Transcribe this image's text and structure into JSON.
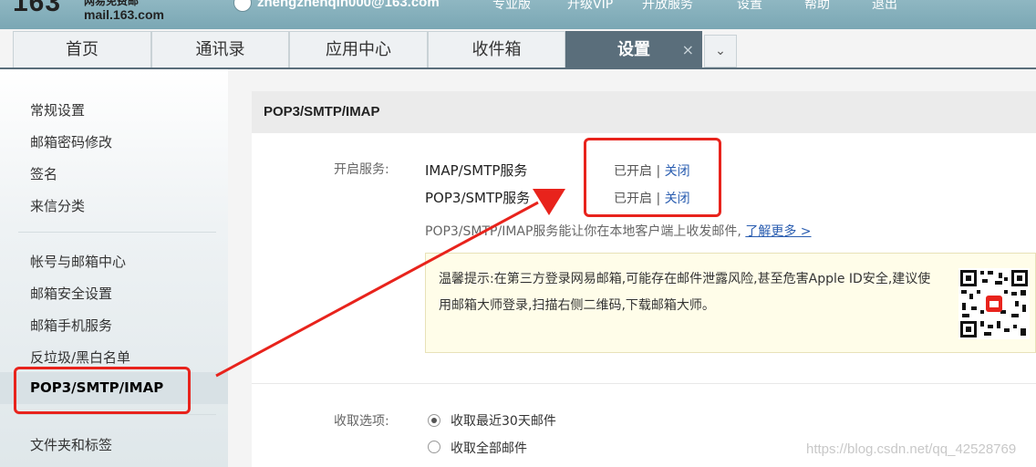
{
  "header": {
    "logo_number": "163",
    "logo_free": "网易免费邮",
    "logo_domain": "mail.163.com",
    "user_email": "zhengzhenqin000@163.com",
    "nav": [
      "专业版",
      "升级VIP",
      "开放服务",
      "设置",
      "帮助",
      "退出"
    ]
  },
  "tabs": [
    {
      "label": "首页"
    },
    {
      "label": "通讯录"
    },
    {
      "label": "应用中心"
    },
    {
      "label": "收件箱"
    },
    {
      "label": "设置",
      "active": true
    }
  ],
  "tab_close": "×",
  "tab_more": "⌄",
  "sidebar": {
    "items": [
      "常规设置",
      "邮箱密码修改",
      "签名",
      "来信分类",
      "帐号与邮箱中心",
      "邮箱安全设置",
      "邮箱手机服务",
      "反垃圾/黑白名单",
      "POP3/SMTP/IMAP",
      "文件夹和标签"
    ],
    "active_index": 8
  },
  "panel": {
    "title": "POP3/SMTP/IMAP",
    "service_label": "开启服务:",
    "services": [
      {
        "name": "IMAP/SMTP服务",
        "status": "已开启",
        "sep": "|",
        "action": "关闭"
      },
      {
        "name": "POP3/SMTP服务",
        "status": "已开启",
        "sep": "|",
        "action": "关闭"
      }
    ],
    "desc": "POP3/SMTP/IMAP服务能让你在本地客户端上收发邮件,",
    "learn_more": "了解更多 >",
    "notice": "温馨提示:在第三方登录网易邮箱,可能存在邮件泄露风险,甚至危害Apple ID安全,建议使用邮箱大师登录,扫描右侧二维码,下载邮箱大师。",
    "fetch_label": "收取选项:",
    "fetch_options": [
      {
        "label": "收取最近30天邮件",
        "checked": true
      },
      {
        "label": "收取全部邮件",
        "checked": false
      }
    ]
  },
  "watermark": "https://blog.csdn.net/qq_42528769",
  "colors": {
    "accent": "#5a6e7b",
    "link": "#2a5db0",
    "annotation": "#e8231c",
    "notice_bg": "#fffde9"
  }
}
